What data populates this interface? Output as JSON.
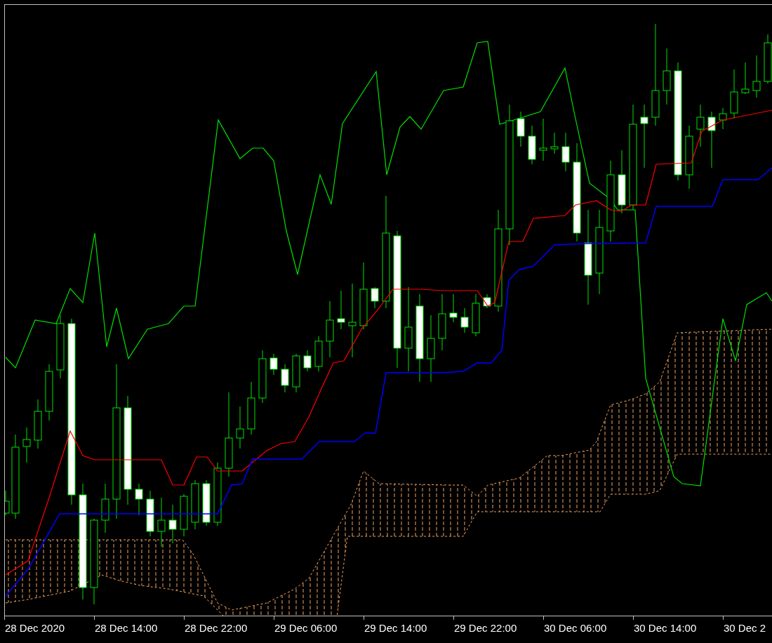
{
  "chart": {
    "time_axis": [
      "28 Dec 2020",
      "28 Dec 14:00",
      "28 Dec 22:00",
      "29 Dec 06:00",
      "29 Dec 14:00",
      "29 Dec 22:00",
      "30 Dec 06:00",
      "30 Dec 14:00",
      "30 Dec 2"
    ]
  }
}
